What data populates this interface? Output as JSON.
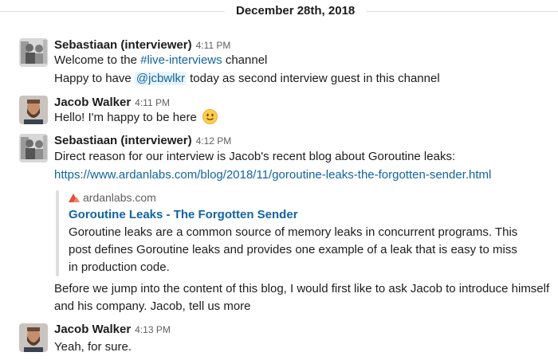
{
  "date_divider": "December 28th, 2018",
  "messages": [
    {
      "author": "Sebastiaan (interviewer)",
      "time": "4:11 PM",
      "line1_prefix": "Welcome to the ",
      "channel": "#live-interviews",
      "line1_suffix": " channel",
      "line2_prefix": "Happy to have ",
      "mention": "@jcbwlkr",
      "line2_suffix": " today as second interview guest in this channel"
    },
    {
      "author": "Jacob Walker",
      "time": "4:11 PM",
      "text": "Hello! I'm happy to be here",
      "emoji": "slightly-smiling-face"
    },
    {
      "author": "Sebastiaan (interviewer)",
      "time": "4:12 PM",
      "text1": "Direct reason for our interview is Jacob's recent blog about Goroutine leaks:",
      "url": "https://www.ardanlabs.com/blog/2018/11/goroutine-leaks-the-forgotten-sender.html",
      "unfurl": {
        "site": "ardanlabs.com",
        "title": "Goroutine Leaks - The Forgotten Sender",
        "desc1": "Goroutine leaks are a common source of memory leaks in concurrent programs. This",
        "desc2": "post defines Goroutine leaks and provides one example of a leak that is easy to miss",
        "desc3": "in production code."
      },
      "text2": "Before we jump into the content of this blog, I would first like to ask Jacob to introduce himself",
      "text3": "and his company. Jacob, tell us more"
    },
    {
      "author": "Jacob Walker",
      "time": "4:13 PM",
      "text": "Yeah, for sure."
    }
  ]
}
